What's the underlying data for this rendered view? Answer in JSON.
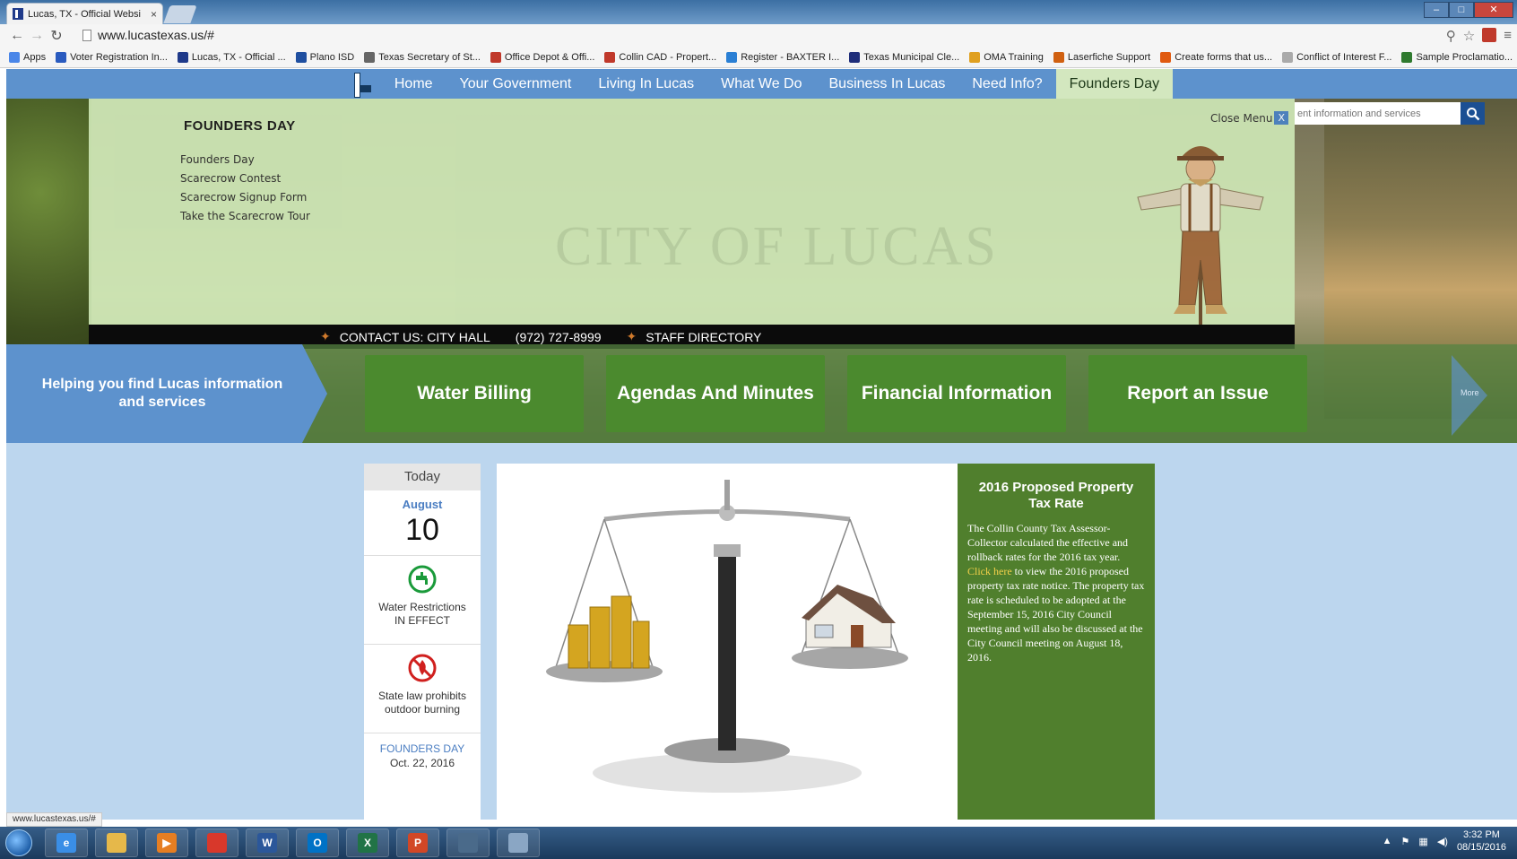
{
  "browser": {
    "tab_title": "Lucas, TX - Official Websi",
    "tab_close": "×",
    "url": "www.lucastexas.us/#",
    "bookmarks": [
      {
        "label": "Apps",
        "color": "#4a86e8"
      },
      {
        "label": "Voter Registration In...",
        "color": "#2a5bbf"
      },
      {
        "label": "Lucas, TX - Official ...",
        "color": "#1f3a8a"
      },
      {
        "label": "Plano ISD",
        "color": "#1f4fa0"
      },
      {
        "label": "Texas Secretary of St...",
        "color": "#666666"
      },
      {
        "label": "Office Depot & Offi...",
        "color": "#c0392b"
      },
      {
        "label": "Collin CAD - Propert...",
        "color": "#c0392b"
      },
      {
        "label": "Register - BAXTER I...",
        "color": "#2a7fd4"
      },
      {
        "label": "Texas Municipal Cle...",
        "color": "#1f2e7a"
      },
      {
        "label": "OMA Training",
        "color": "#e0a020"
      },
      {
        "label": "Laserfiche Support",
        "color": "#d06010"
      },
      {
        "label": "Create forms that us...",
        "color": "#e05a10"
      },
      {
        "label": "Conflict of Interest F...",
        "color": "#aaaaaa"
      },
      {
        "label": "Sample Proclamatio...",
        "color": "#2f7a2f"
      }
    ]
  },
  "site": {
    "nav": [
      "Home",
      "Your Government",
      "Living In Lucas",
      "What We Do",
      "Business In Lucas",
      "Need Info?",
      "Founders Day"
    ],
    "mega_menu": {
      "title": "FOUNDERS DAY",
      "links": [
        "Founders Day",
        "Scarecrow Contest",
        "Scarecrow Signup Form",
        "Take the Scarecrow Tour"
      ],
      "close_label": "Close Menu",
      "close_x": "X",
      "watermark": "CITY OF LUCAS"
    },
    "contact": {
      "label": "CONTACT US: CITY HALL",
      "phone": "(972) 727-8999",
      "staff": "STAFF DIRECTORY"
    },
    "search_placeholder": "ent information and services",
    "helping_text": "Helping you find Lucas information and services",
    "quick_links": [
      "Water Billing",
      "Agendas And Minutes",
      "Financial Information",
      "Report an Issue"
    ],
    "more_label": "More",
    "today": {
      "head": "Today",
      "month": "August",
      "day": "10",
      "notices": [
        {
          "icon": "water-tap-icon",
          "text_line1": "Water Restrictions",
          "text_line2": "IN EFFECT"
        },
        {
          "icon": "no-burning-icon",
          "text_line1": "State law prohibits",
          "text_line2": "outdoor burning"
        }
      ],
      "event_label": "FOUNDERS DAY",
      "event_date": "Oct. 22, 2016"
    },
    "news": {
      "title": "2016 Proposed Property Tax Rate",
      "body_before": "The Collin County Tax Assessor-Collector calculated the effective and rollback rates for the 2016 tax year. ",
      "link": "Click here",
      "body_after": " to view the 2016 proposed property tax rate notice. The property tax rate is scheduled to be adopted at the September 15, 2016 City Council meeting and will also be discussed at the City Council meeting on August 18, 2016."
    },
    "status_url": "www.lucastexas.us/#"
  },
  "taskbar": {
    "apps": [
      {
        "name": "ie",
        "label": "e",
        "color": "#3a8ee6"
      },
      {
        "name": "explorer",
        "label": "",
        "color": "#e6b84a"
      },
      {
        "name": "media-player",
        "label": "▶",
        "color": "#e67e22"
      },
      {
        "name": "chrome",
        "label": "",
        "color": "#d8382b"
      },
      {
        "name": "word",
        "label": "W",
        "color": "#2b579a"
      },
      {
        "name": "outlook",
        "label": "O",
        "color": "#0072c6"
      },
      {
        "name": "excel",
        "label": "X",
        "color": "#217346"
      },
      {
        "name": "powerpoint",
        "label": "P",
        "color": "#d24726"
      },
      {
        "name": "publisher",
        "label": "",
        "color": "#4a6a8a"
      },
      {
        "name": "snipping-tool",
        "label": "",
        "color": "#8aa6c4"
      }
    ],
    "time": "3:32 PM",
    "date": "08/15/2016"
  },
  "colors": {
    "nav_blue": "#5d92cd",
    "menu_green": "#cde6b5",
    "button_green": "#4b8a2e",
    "news_green": "#507f2d",
    "link_yellow": "#f2d04a"
  }
}
